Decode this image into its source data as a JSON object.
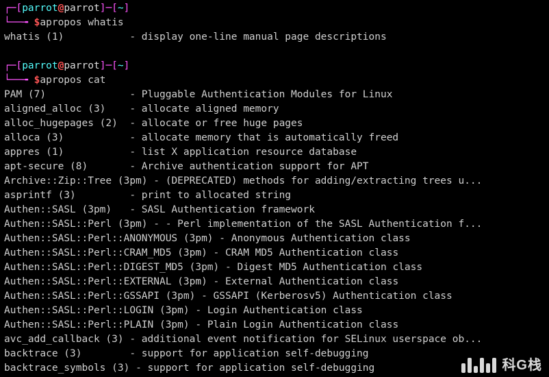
{
  "prompt": {
    "lbr": "┌─[",
    "user": "parrot",
    "at": "@",
    "host": "parrot",
    "rbr1": "]─[",
    "tilde": "~",
    "rbr2": "]",
    "l2a": "└──╼ ",
    "dollar": "$"
  },
  "cmd1": "apropos whatis",
  "out1_left": "whatis (1)           ",
  "out1_desc": "- display one-line manual page descriptions",
  "cmd2": "apropos cat",
  "res": [
    {
      "l": "PAM (7)              ",
      "d": "- Pluggable Authentication Modules for Linux"
    },
    {
      "l": "aligned_alloc (3)    ",
      "d": "- allocate aligned memory"
    },
    {
      "l": "alloc_hugepages (2)  ",
      "d": "- allocate or free huge pages"
    },
    {
      "l": "alloca (3)           ",
      "d": "- allocate memory that is automatically freed"
    },
    {
      "l": "appres (1)           ",
      "d": "- list X application resource database"
    },
    {
      "l": "apt-secure (8)       ",
      "d": "- Archive authentication support for APT"
    },
    {
      "l": "Archive::Zip::Tree (3pm) ",
      "d": "- (DEPRECATED) methods for adding/extracting trees u..."
    },
    {
      "l": "asprintf (3)         ",
      "d": "- print to allocated string"
    },
    {
      "l": "Authen::SASL (3pm)   ",
      "d": "- SASL Authentication framework"
    },
    {
      "l": "Authen::SASL::Perl (3pm) ",
      "d": "- - Perl implementation of the SASL Authentication f..."
    },
    {
      "l": "Authen::SASL::Perl::ANONYMOUS (3pm) ",
      "d": "- Anonymous Authentication class"
    },
    {
      "l": "Authen::SASL::Perl::CRAM_MD5 (3pm) ",
      "d": "- CRAM MD5 Authentication class"
    },
    {
      "l": "Authen::SASL::Perl::DIGEST_MD5 (3pm) ",
      "d": "- Digest MD5 Authentication class"
    },
    {
      "l": "Authen::SASL::Perl::EXTERNAL (3pm) ",
      "d": "- External Authentication class"
    },
    {
      "l": "Authen::SASL::Perl::GSSAPI (3pm) ",
      "d": "- GSSAPI (Kerberosv5) Authentication class"
    },
    {
      "l": "Authen::SASL::Perl::LOGIN (3pm) ",
      "d": "- Login Authentication class"
    },
    {
      "l": "Authen::SASL::Perl::PLAIN (3pm) ",
      "d": "- Plain Login Authentication class"
    },
    {
      "l": "avc_add_callback (3) ",
      "d": "- additional event notification for SELinux userspace ob..."
    },
    {
      "l": "backtrace (3)        ",
      "d": "- support for application self-debugging"
    },
    {
      "l": "backtrace_symbols (3) ",
      "d": "- support for application self-debugging"
    }
  ],
  "watermark": "科G栈"
}
